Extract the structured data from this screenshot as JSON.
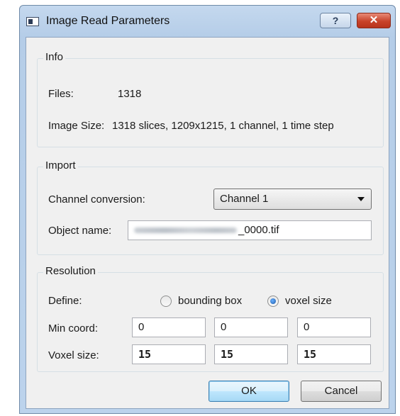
{
  "window": {
    "title": "Image Read Parameters",
    "help_label": "?",
    "close_label": "✕"
  },
  "info": {
    "group_title": "Info",
    "files_label": "Files:",
    "files_value": "1318",
    "image_size_label": "Image Size:",
    "image_size_value": "1318 slices, 1209x1215, 1 channel, 1 time step"
  },
  "import": {
    "group_title": "Import",
    "channel_conversion_label": "Channel conversion:",
    "channel_conversion_value": "Channel 1",
    "object_name_label": "Object name:",
    "object_name_visible_suffix": "_0000.tif"
  },
  "resolution": {
    "group_title": "Resolution",
    "define_label": "Define:",
    "option_bounding_box": "bounding box",
    "option_voxel_size": "voxel size",
    "selected_option": "voxel size",
    "min_coord_label": "Min coord:",
    "min_coord": [
      "0",
      "0",
      "0"
    ],
    "voxel_size_label": "Voxel size:",
    "voxel_size": [
      "15",
      "15",
      "15"
    ]
  },
  "buttons": {
    "ok": "OK",
    "cancel": "Cancel"
  },
  "colors": {
    "title_bar": "#b5cde8",
    "client_bg": "#f0f0f0",
    "close_button": "#c8432a",
    "default_button_border": "#3c7fb1"
  }
}
